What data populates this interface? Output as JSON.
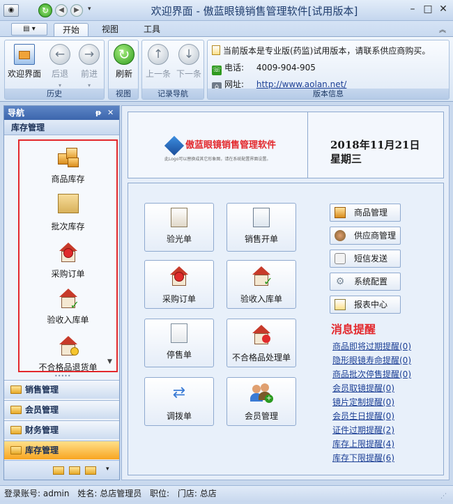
{
  "window": {
    "title": "欢迎界面 - 傲蓝眼镜销售管理软件[试用版本]"
  },
  "tabs": [
    {
      "label": "开始"
    },
    {
      "label": "视图"
    },
    {
      "label": "工具"
    }
  ],
  "ribbon": {
    "groups": {
      "history": "历史",
      "view": "视图",
      "nav": "记录导航",
      "version": "版本信息"
    },
    "buttons": {
      "welcome": "欢迎界面",
      "back": "后退",
      "forward": "前进",
      "refresh": "刷新",
      "prev": "上一条",
      "next": "下一条"
    },
    "info": {
      "notice": "当前版本是专业版(药监)试用版本，请联系供应商购买。",
      "phone_label": "电话:",
      "phone": "4009-904-905",
      "site_label": "网址:",
      "site": "http://www.aolan.net/"
    }
  },
  "nav": {
    "title": "导航",
    "pin": "ᵽ",
    "close": "✕",
    "section": "库存管理",
    "items": [
      {
        "label": "商品库存"
      },
      {
        "label": "批次库存"
      },
      {
        "label": "采购订单"
      },
      {
        "label": "验收入库单"
      },
      {
        "label": "不合格品退货单"
      }
    ],
    "categories": [
      {
        "label": "销售管理"
      },
      {
        "label": "会员管理"
      },
      {
        "label": "财务管理"
      },
      {
        "label": "库存管理"
      }
    ]
  },
  "main": {
    "logo": {
      "name": "傲蓝眼镜销售管理软件",
      "caption": "此Logo可以替换成其它形象图，请在系统配置界面设置。"
    },
    "date": "2018年11月21日",
    "weekday": "星期三",
    "functions": [
      {
        "label": "验光单"
      },
      {
        "label": "销售开单"
      },
      {
        "label": "采购订单"
      },
      {
        "label": "验收入库单"
      },
      {
        "label": "停售单"
      },
      {
        "label": "不合格品处理单"
      },
      {
        "label": "调拨单"
      },
      {
        "label": "会员管理"
      }
    ],
    "side_buttons": [
      {
        "label": "商品管理"
      },
      {
        "label": "供应商管理"
      },
      {
        "label": "短信发送"
      },
      {
        "label": "系统配置"
      },
      {
        "label": "报表中心"
      }
    ],
    "messages": {
      "title": "消息提醒",
      "items": [
        {
          "label": "商品即将过期提醒(0)"
        },
        {
          "label": "隐形眼镜寿命提醒(0)"
        },
        {
          "label": "商品批次停售提醒(0)"
        },
        {
          "label": "会员取镜提醒(0)"
        },
        {
          "label": "镜片定制提醒(0)"
        },
        {
          "label": "会员生日提醒(0)"
        },
        {
          "label": "证件过期提醒(2)"
        },
        {
          "label": "库存上限提醒(4)"
        },
        {
          "label": "库存下限提醒(6)"
        }
      ]
    }
  },
  "status": {
    "account_label": "登录账号:",
    "account": "admin",
    "name_label": "姓名:",
    "name": "总店管理员",
    "position_label": "职位:",
    "position": "",
    "store_label": "门店:",
    "store": "总店"
  },
  "colors": {
    "accent": "#3c66ad",
    "alert": "#e3282c",
    "link": "#1c3f95",
    "active_tab": "#f8a521"
  }
}
